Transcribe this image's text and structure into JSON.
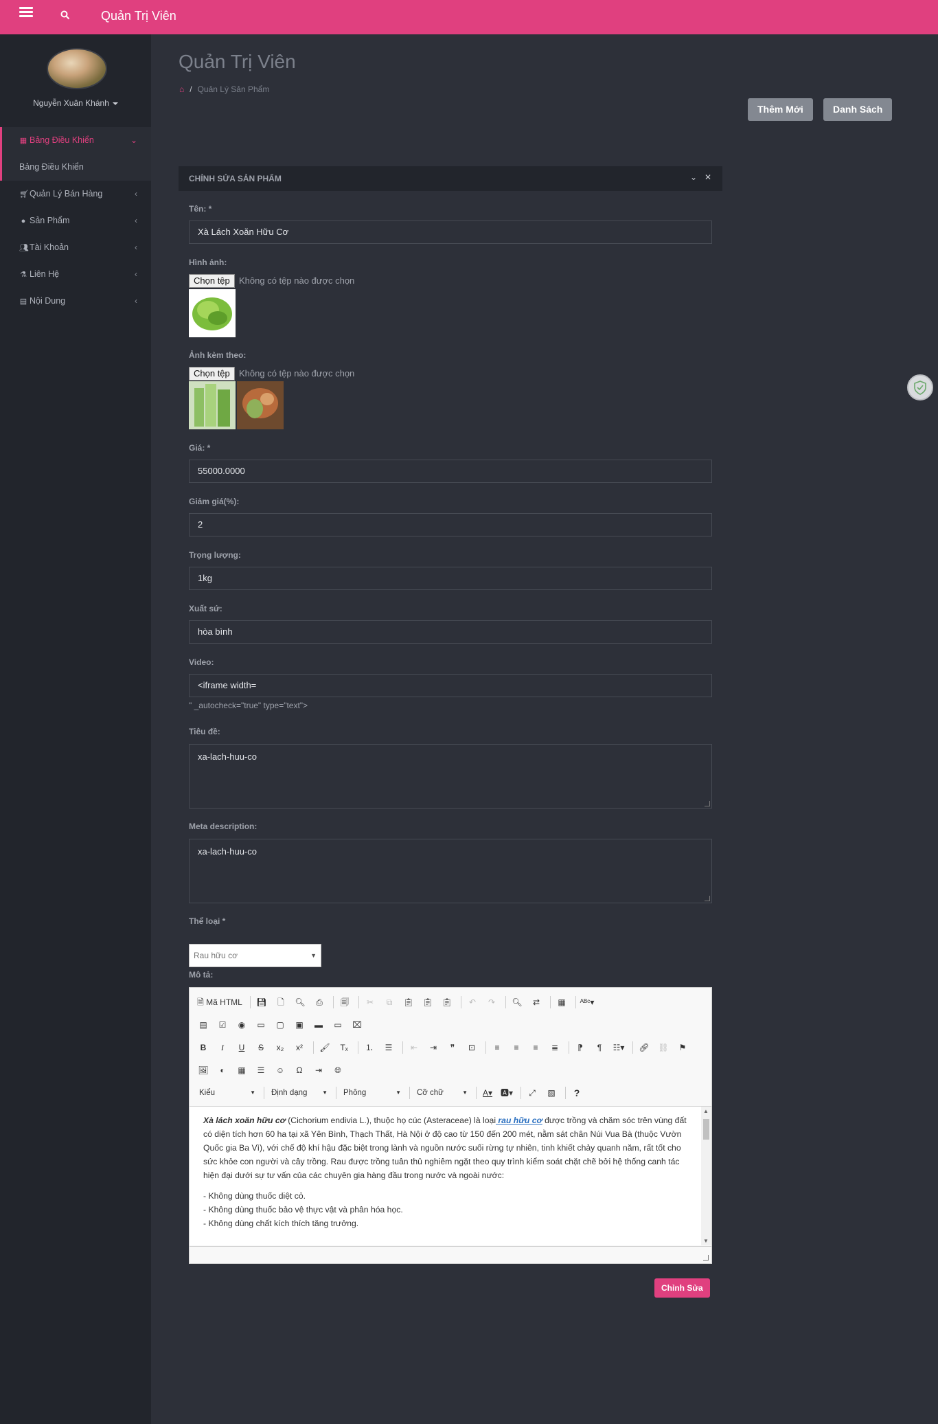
{
  "app": {
    "brand": "Quản Trị Viên"
  },
  "user": {
    "name": "Nguyễn Xuân Khánh"
  },
  "sidebar": {
    "items": [
      {
        "label": "Bảng Điều Khiển",
        "icon": "dashboard-icon"
      },
      {
        "label": "Bảng Điều Khiển"
      },
      {
        "label": "Quản Lý Bán Hàng",
        "icon": "cart-icon"
      },
      {
        "label": "Sản Phẩm",
        "icon": "product-icon"
      },
      {
        "label": "Tài Khoản",
        "icon": "users-icon"
      },
      {
        "label": "Liên Hệ",
        "icon": "flask-icon"
      },
      {
        "label": "Nội Dung",
        "icon": "table-icon"
      }
    ]
  },
  "page": {
    "title": "Quản Trị Viên",
    "breadcrumb": "Quản Lý Sản Phẩm",
    "add_button": "Thêm Mới",
    "list_button": "Danh Sách"
  },
  "panel": {
    "title": "CHỈNH SỬA SẢN PHẨM"
  },
  "form": {
    "name_label": "Tên: *",
    "name_value": "Xà Lách Xoăn Hữu Cơ",
    "image_label": "Hình ảnh:",
    "file_button": "Chọn tệp",
    "no_file": "Không có tệp nào được chọn",
    "extra_images_label": "Ảnh kèm theo:",
    "price_label": "Giá: *",
    "price_value": "55000.0000",
    "discount_label": "Giảm giá(%):",
    "discount_value": "2",
    "weight_label": "Trọng lượng:",
    "weight_value": "1kg",
    "origin_label": "Xuất sứ:",
    "origin_value": "hòa bình",
    "video_label": "Video:",
    "video_value": "<iframe width=",
    "video_hint": "\" _autocheck=\"true\" type=\"text\">",
    "title_label": "Tiêu đề:",
    "title_value": "xa-lach-huu-co",
    "meta_label": "Meta description:",
    "meta_value": "xa-lach-huu-co",
    "category_label": "Thể loại *",
    "category_value": "Rau hữu cơ",
    "desc_label": "Mô tả:",
    "submit": "Chỉnh Sửa"
  },
  "editor": {
    "source_label": "Mã HTML",
    "style_combo": "Kiểu",
    "format_combo": "Định dạng",
    "font_combo": "Phông",
    "size_combo": "Cỡ chữ",
    "p1_bold": "Xà lách xoăn hữu cơ",
    "p1_a": " (Cichorium endivia L.), thuộc họ cúc (Asteraceae) là loại",
    "p1_link": " rau hữu cơ",
    "p1_b": " được trồng và chăm sóc trên vùng đất có diện tích hơn 60 ha tại xã Yên Bình, Thạch Thất, Hà Nội ở độ cao từ 150 đến 200 mét, nằm sát chân Núi Vua Bà (thuộc Vườn Quốc gia Ba Vì), với chế độ khí hậu đặc biệt trong lành và nguồn nước suối rừng tự nhiên, tinh khiết chảy quanh năm, rất tốt cho sức khỏe con người và cây trồng. Rau được trồng tuân thủ nghiêm ngặt theo quy trình kiểm soát chặt chẽ bởi hệ thống canh tác hiện đại dưới sự tư vấn của các chuyên gia hàng đầu trong nước và ngoài nước:",
    "l1": "- Không dùng thuốc diệt cỏ.",
    "l2": "- Không dùng thuốc bảo vệ thực vật và phân hóa học.",
    "l3": "- Không dùng chất kích thích tăng trưởng."
  },
  "colors": {
    "accent": "#e0407f",
    "sidebar": "#22252c",
    "background": "#2d3039"
  }
}
